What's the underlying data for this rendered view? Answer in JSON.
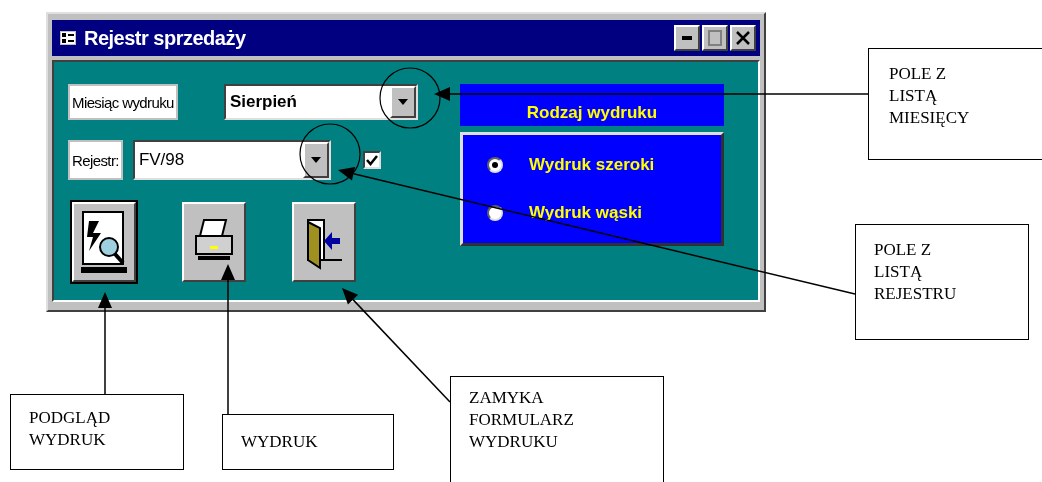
{
  "window": {
    "title": "Rejestr sprzedaży"
  },
  "month": {
    "label": "Miesiąc wydruku",
    "value": "Sierpień"
  },
  "register": {
    "label": "Rejestr:",
    "value": "FV/98",
    "checked": true
  },
  "print_type": {
    "title": "Rodzaj wydruku",
    "options": [
      {
        "label": "Wydruk szeroki",
        "selected": true
      },
      {
        "label": "Wydruk wąski",
        "selected": false
      }
    ]
  },
  "buttons": [
    {
      "kind": "preview"
    },
    {
      "kind": "print"
    },
    {
      "kind": "close"
    }
  ],
  "callouts": [
    {
      "text": "POLE  Z\nLISTĄ\nMIESIĘCY"
    },
    {
      "text": "POLE Z\nLISTĄ\nREJESTRU"
    },
    {
      "text": "PODGLĄD\nWYDRUK"
    },
    {
      "text": "WYDRUK"
    },
    {
      "text": "ZAMYKA\nFORMULARZ\nWYDRUKU"
    }
  ]
}
